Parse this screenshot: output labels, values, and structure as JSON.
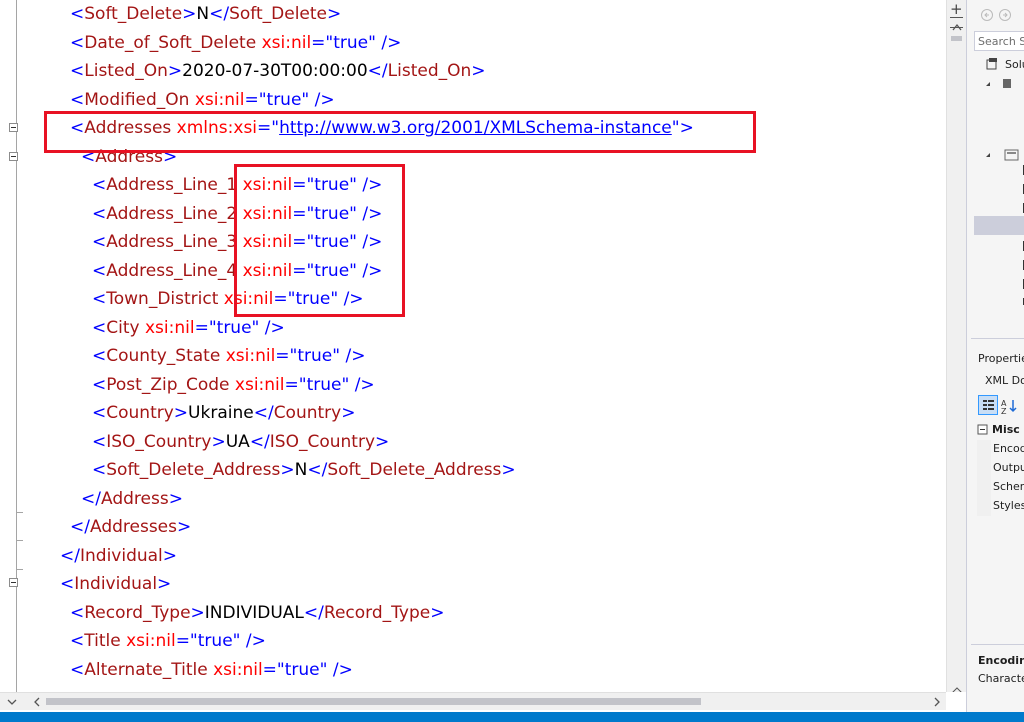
{
  "editor": {
    "lines": [
      [
        {
          "c": "b",
          "t": "<"
        },
        {
          "c": "e",
          "t": "Soft_Delete"
        },
        {
          "c": "b",
          "t": ">"
        },
        {
          "c": "t",
          "t": "N"
        },
        {
          "c": "b",
          "t": "</"
        },
        {
          "c": "e",
          "t": "Soft_Delete"
        },
        {
          "c": "b",
          "t": ">"
        }
      ],
      [
        {
          "c": "b",
          "t": "<"
        },
        {
          "c": "e",
          "t": "Date_of_Soft_Delete"
        },
        {
          "c": "a",
          "t": " xsi:nil"
        },
        {
          "c": "b",
          "t": "=\""
        },
        {
          "c": "b",
          "t": "true"
        },
        {
          "c": "b",
          "t": "\" />"
        }
      ],
      [
        {
          "c": "b",
          "t": "<"
        },
        {
          "c": "e",
          "t": "Listed_On"
        },
        {
          "c": "b",
          "t": ">"
        },
        {
          "c": "t",
          "t": "2020-07-30T00:00:00"
        },
        {
          "c": "b",
          "t": "</"
        },
        {
          "c": "e",
          "t": "Listed_On"
        },
        {
          "c": "b",
          "t": ">"
        }
      ],
      [
        {
          "c": "b",
          "t": "<"
        },
        {
          "c": "e",
          "t": "Modified_On"
        },
        {
          "c": "a",
          "t": " xsi:nil"
        },
        {
          "c": "b",
          "t": "=\""
        },
        {
          "c": "b",
          "t": "true"
        },
        {
          "c": "b",
          "t": "\" />"
        }
      ],
      [
        {
          "c": "b",
          "t": "<"
        },
        {
          "c": "e",
          "t": "Addresses"
        },
        {
          "c": "a",
          "t": " xmlns:xsi"
        },
        {
          "c": "b",
          "t": "=\""
        },
        {
          "c": "link",
          "t": "http://www.w3.org/2001/XMLSchema-instance"
        },
        {
          "c": "b",
          "t": "\">"
        }
      ],
      [
        {
          "c": "b",
          "t": "<"
        },
        {
          "c": "e",
          "t": "Address"
        },
        {
          "c": "b",
          "t": ">"
        }
      ],
      [
        {
          "c": "b",
          "t": "<"
        },
        {
          "c": "e",
          "t": "Address_Line_1"
        },
        {
          "c": "a",
          "t": " xsi:nil"
        },
        {
          "c": "b",
          "t": "=\""
        },
        {
          "c": "b",
          "t": "true"
        },
        {
          "c": "b",
          "t": "\" />"
        }
      ],
      [
        {
          "c": "b",
          "t": "<"
        },
        {
          "c": "e",
          "t": "Address_Line_2"
        },
        {
          "c": "a",
          "t": " xsi:nil"
        },
        {
          "c": "b",
          "t": "=\""
        },
        {
          "c": "b",
          "t": "true"
        },
        {
          "c": "b",
          "t": "\" />"
        }
      ],
      [
        {
          "c": "b",
          "t": "<"
        },
        {
          "c": "e",
          "t": "Address_Line_3"
        },
        {
          "c": "a",
          "t": " xsi:nil"
        },
        {
          "c": "b",
          "t": "=\""
        },
        {
          "c": "b",
          "t": "true"
        },
        {
          "c": "b",
          "t": "\" />"
        }
      ],
      [
        {
          "c": "b",
          "t": "<"
        },
        {
          "c": "e",
          "t": "Address_Line_4"
        },
        {
          "c": "a",
          "t": " xsi:nil"
        },
        {
          "c": "b",
          "t": "=\""
        },
        {
          "c": "b",
          "t": "true"
        },
        {
          "c": "b",
          "t": "\" />"
        }
      ],
      [
        {
          "c": "b",
          "t": "<"
        },
        {
          "c": "e",
          "t": "Town_District"
        },
        {
          "c": "a",
          "t": " xsi:nil"
        },
        {
          "c": "b",
          "t": "=\""
        },
        {
          "c": "b",
          "t": "true"
        },
        {
          "c": "b",
          "t": "\" />"
        }
      ],
      [
        {
          "c": "b",
          "t": "<"
        },
        {
          "c": "e",
          "t": "City"
        },
        {
          "c": "a",
          "t": " xsi:nil"
        },
        {
          "c": "b",
          "t": "=\""
        },
        {
          "c": "b",
          "t": "true"
        },
        {
          "c": "b",
          "t": "\" />"
        }
      ],
      [
        {
          "c": "b",
          "t": "<"
        },
        {
          "c": "e",
          "t": "County_State"
        },
        {
          "c": "a",
          "t": " xsi:nil"
        },
        {
          "c": "b",
          "t": "=\""
        },
        {
          "c": "b",
          "t": "true"
        },
        {
          "c": "b",
          "t": "\" />"
        }
      ],
      [
        {
          "c": "b",
          "t": "<"
        },
        {
          "c": "e",
          "t": "Post_Zip_Code"
        },
        {
          "c": "a",
          "t": " xsi:nil"
        },
        {
          "c": "b",
          "t": "=\""
        },
        {
          "c": "b",
          "t": "true"
        },
        {
          "c": "b",
          "t": "\" />"
        }
      ],
      [
        {
          "c": "b",
          "t": "<"
        },
        {
          "c": "e",
          "t": "Country"
        },
        {
          "c": "b",
          "t": ">"
        },
        {
          "c": "t",
          "t": "Ukraine"
        },
        {
          "c": "b",
          "t": "</"
        },
        {
          "c": "e",
          "t": "Country"
        },
        {
          "c": "b",
          "t": ">"
        }
      ],
      [
        {
          "c": "b",
          "t": "<"
        },
        {
          "c": "e",
          "t": "ISO_Country"
        },
        {
          "c": "b",
          "t": ">"
        },
        {
          "c": "t",
          "t": "UA"
        },
        {
          "c": "b",
          "t": "</"
        },
        {
          "c": "e",
          "t": "ISO_Country"
        },
        {
          "c": "b",
          "t": ">"
        }
      ],
      [
        {
          "c": "b",
          "t": "<"
        },
        {
          "c": "e",
          "t": "Soft_Delete_Address"
        },
        {
          "c": "b",
          "t": ">"
        },
        {
          "c": "t",
          "t": "N"
        },
        {
          "c": "b",
          "t": "</"
        },
        {
          "c": "e",
          "t": "Soft_Delete_Address"
        },
        {
          "c": "b",
          "t": ">"
        }
      ],
      [
        {
          "c": "b",
          "t": "</"
        },
        {
          "c": "e",
          "t": "Address"
        },
        {
          "c": "b",
          "t": ">"
        }
      ],
      [
        {
          "c": "b",
          "t": "</"
        },
        {
          "c": "e",
          "t": "Addresses"
        },
        {
          "c": "b",
          "t": ">"
        }
      ],
      [
        {
          "c": "b",
          "t": "</"
        },
        {
          "c": "e",
          "t": "Individual"
        },
        {
          "c": "b",
          "t": ">"
        }
      ],
      [
        {
          "c": "b",
          "t": "<"
        },
        {
          "c": "e",
          "t": "Individual"
        },
        {
          "c": "b",
          "t": ">"
        }
      ],
      [
        {
          "c": "b",
          "t": "<"
        },
        {
          "c": "e",
          "t": "Record_Type"
        },
        {
          "c": "b",
          "t": ">"
        },
        {
          "c": "t",
          "t": "INDIVIDUAL"
        },
        {
          "c": "b",
          "t": "</"
        },
        {
          "c": "e",
          "t": "Record_Type"
        },
        {
          "c": "b",
          "t": ">"
        }
      ],
      [
        {
          "c": "b",
          "t": "<"
        },
        {
          "c": "e",
          "t": "Title"
        },
        {
          "c": "a",
          "t": " xsi:nil"
        },
        {
          "c": "b",
          "t": "=\""
        },
        {
          "c": "b",
          "t": "true"
        },
        {
          "c": "b",
          "t": "\" />"
        }
      ],
      [
        {
          "c": "b",
          "t": "<"
        },
        {
          "c": "e",
          "t": "Alternate_Title"
        },
        {
          "c": "a",
          "t": " xsi:nil"
        },
        {
          "c": "b",
          "t": "=\""
        },
        {
          "c": "b",
          "t": "true"
        },
        {
          "c": "b",
          "t": "\" />"
        }
      ]
    ]
  },
  "solution_explorer": {
    "search_placeholder": "Search So",
    "root_label": "Solu"
  },
  "properties": {
    "title": "Propertie",
    "object_label": "XML Do",
    "category": "Misc",
    "rows": [
      "Encod",
      "Outpu",
      "Schem",
      "Styles"
    ],
    "desc_title": "Encoding",
    "desc_text": "Characte"
  },
  "colors": {
    "bracket": "#0000ff",
    "element": "#a31515",
    "attribute": "#ff0000",
    "text": "#000000",
    "annotation": "#e81123",
    "status": "#007acc"
  }
}
